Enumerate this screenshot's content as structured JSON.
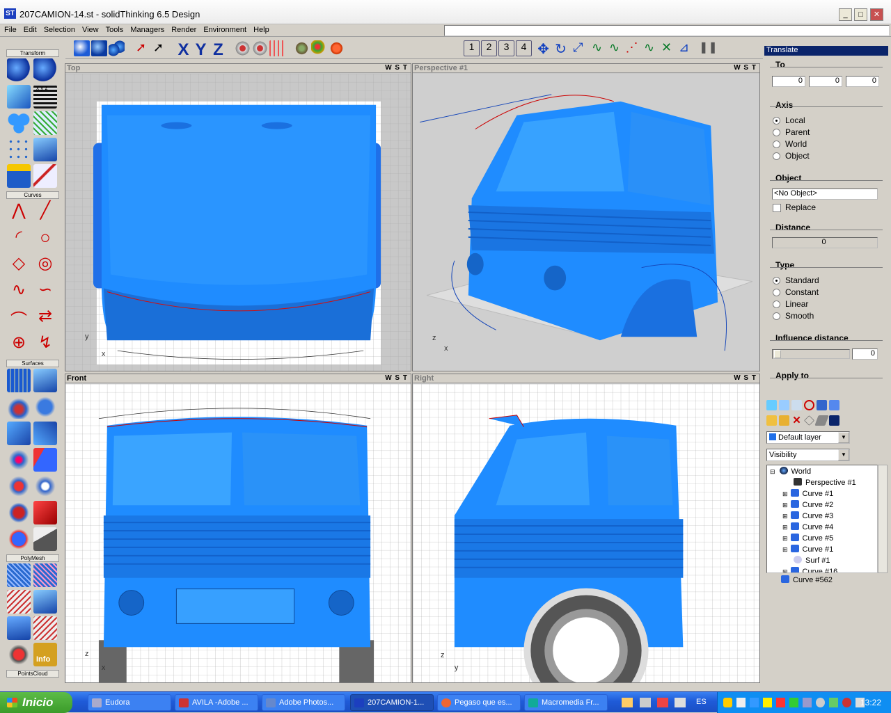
{
  "window": {
    "title": "207CAMION-14.st - solidThinking 6.5 Design",
    "icon": "ST",
    "controls": [
      "_",
      "□",
      "✕"
    ]
  },
  "menu": [
    "File",
    "Edit",
    "Selection",
    "View",
    "Tools",
    "Managers",
    "Render",
    "Environment",
    "Help"
  ],
  "toolbar_icons": [
    "shaded-sphere",
    "solid-sphere",
    "multi-sphere",
    "pick-arrow",
    "select-arrow",
    "x-axis",
    "y-axis",
    "z-axis",
    "snap-grid",
    "snap-point",
    "snap-vertex",
    "gear-render",
    "palette",
    "swirl",
    "view-1",
    "view-2",
    "view-3",
    "view-4",
    "move",
    "rotate",
    "scale",
    "curve-1",
    "curve-2",
    "curve-3",
    "curve-4",
    "curve-5",
    "dimension",
    "pause"
  ],
  "toolbar_view_numbers": [
    "1",
    "2",
    "3",
    "4"
  ],
  "left_groups": [
    "Transform",
    "Curves",
    "Surfaces",
    "PolyMesh",
    "PointsCloud"
  ],
  "left_info": "Info",
  "axis_labels": {
    "xyz": "x y z"
  },
  "viewports": [
    {
      "title": "Top",
      "controls": "W S T",
      "x_label": "x",
      "y_label": "y"
    },
    {
      "title": "Perspective #1",
      "controls": "W S T",
      "x_label": "x",
      "y_label": "z"
    },
    {
      "title": "Front",
      "controls": "W S T",
      "x_label": "x",
      "y_label": "z"
    },
    {
      "title": "Right",
      "controls": "W S T",
      "x_label": "y",
      "y_label": "z"
    }
  ],
  "translate": {
    "panel_title": "Translate",
    "to_label": "To",
    "to_values": [
      "0",
      "0",
      "0"
    ],
    "axis_label": "Axis",
    "axis_options": [
      "Local",
      "Parent",
      "World",
      "Object"
    ],
    "axis_selected": "Local",
    "object_label": "Object",
    "object_value": "<No Object>",
    "replace_label": "Replace",
    "distance_label": "Distance",
    "distance_value": "0",
    "type_label": "Type",
    "type_options": [
      "Standard",
      "Constant",
      "Linear",
      "Smooth"
    ],
    "type_selected": "Standard",
    "influence_label": "Influence distance",
    "influence_value": "0",
    "apply_label": "Apply to"
  },
  "layers": {
    "layer_combo": "Default layer",
    "visibility_combo": "Visibility",
    "tree": [
      "World",
      "Perspective #1",
      "Curve #1",
      "Curve #2",
      "Curve #3",
      "Curve #4",
      "Curve #5",
      "Curve #1",
      "Surf #1",
      "Curve #16"
    ],
    "extra_item": "Curve #562"
  },
  "taskbar": {
    "start": "Inicio",
    "tasks": [
      "Eudora",
      "AVILA -Adobe ...",
      "Adobe Photos...",
      "207CAMION-1...",
      "Pegaso que es...",
      "Macromedia Fr..."
    ],
    "lang": "ES",
    "clock": "13:22"
  },
  "colors": {
    "accent": "#0a246a",
    "model": "#1f8cff",
    "taskbar": "#1f5bd8"
  }
}
